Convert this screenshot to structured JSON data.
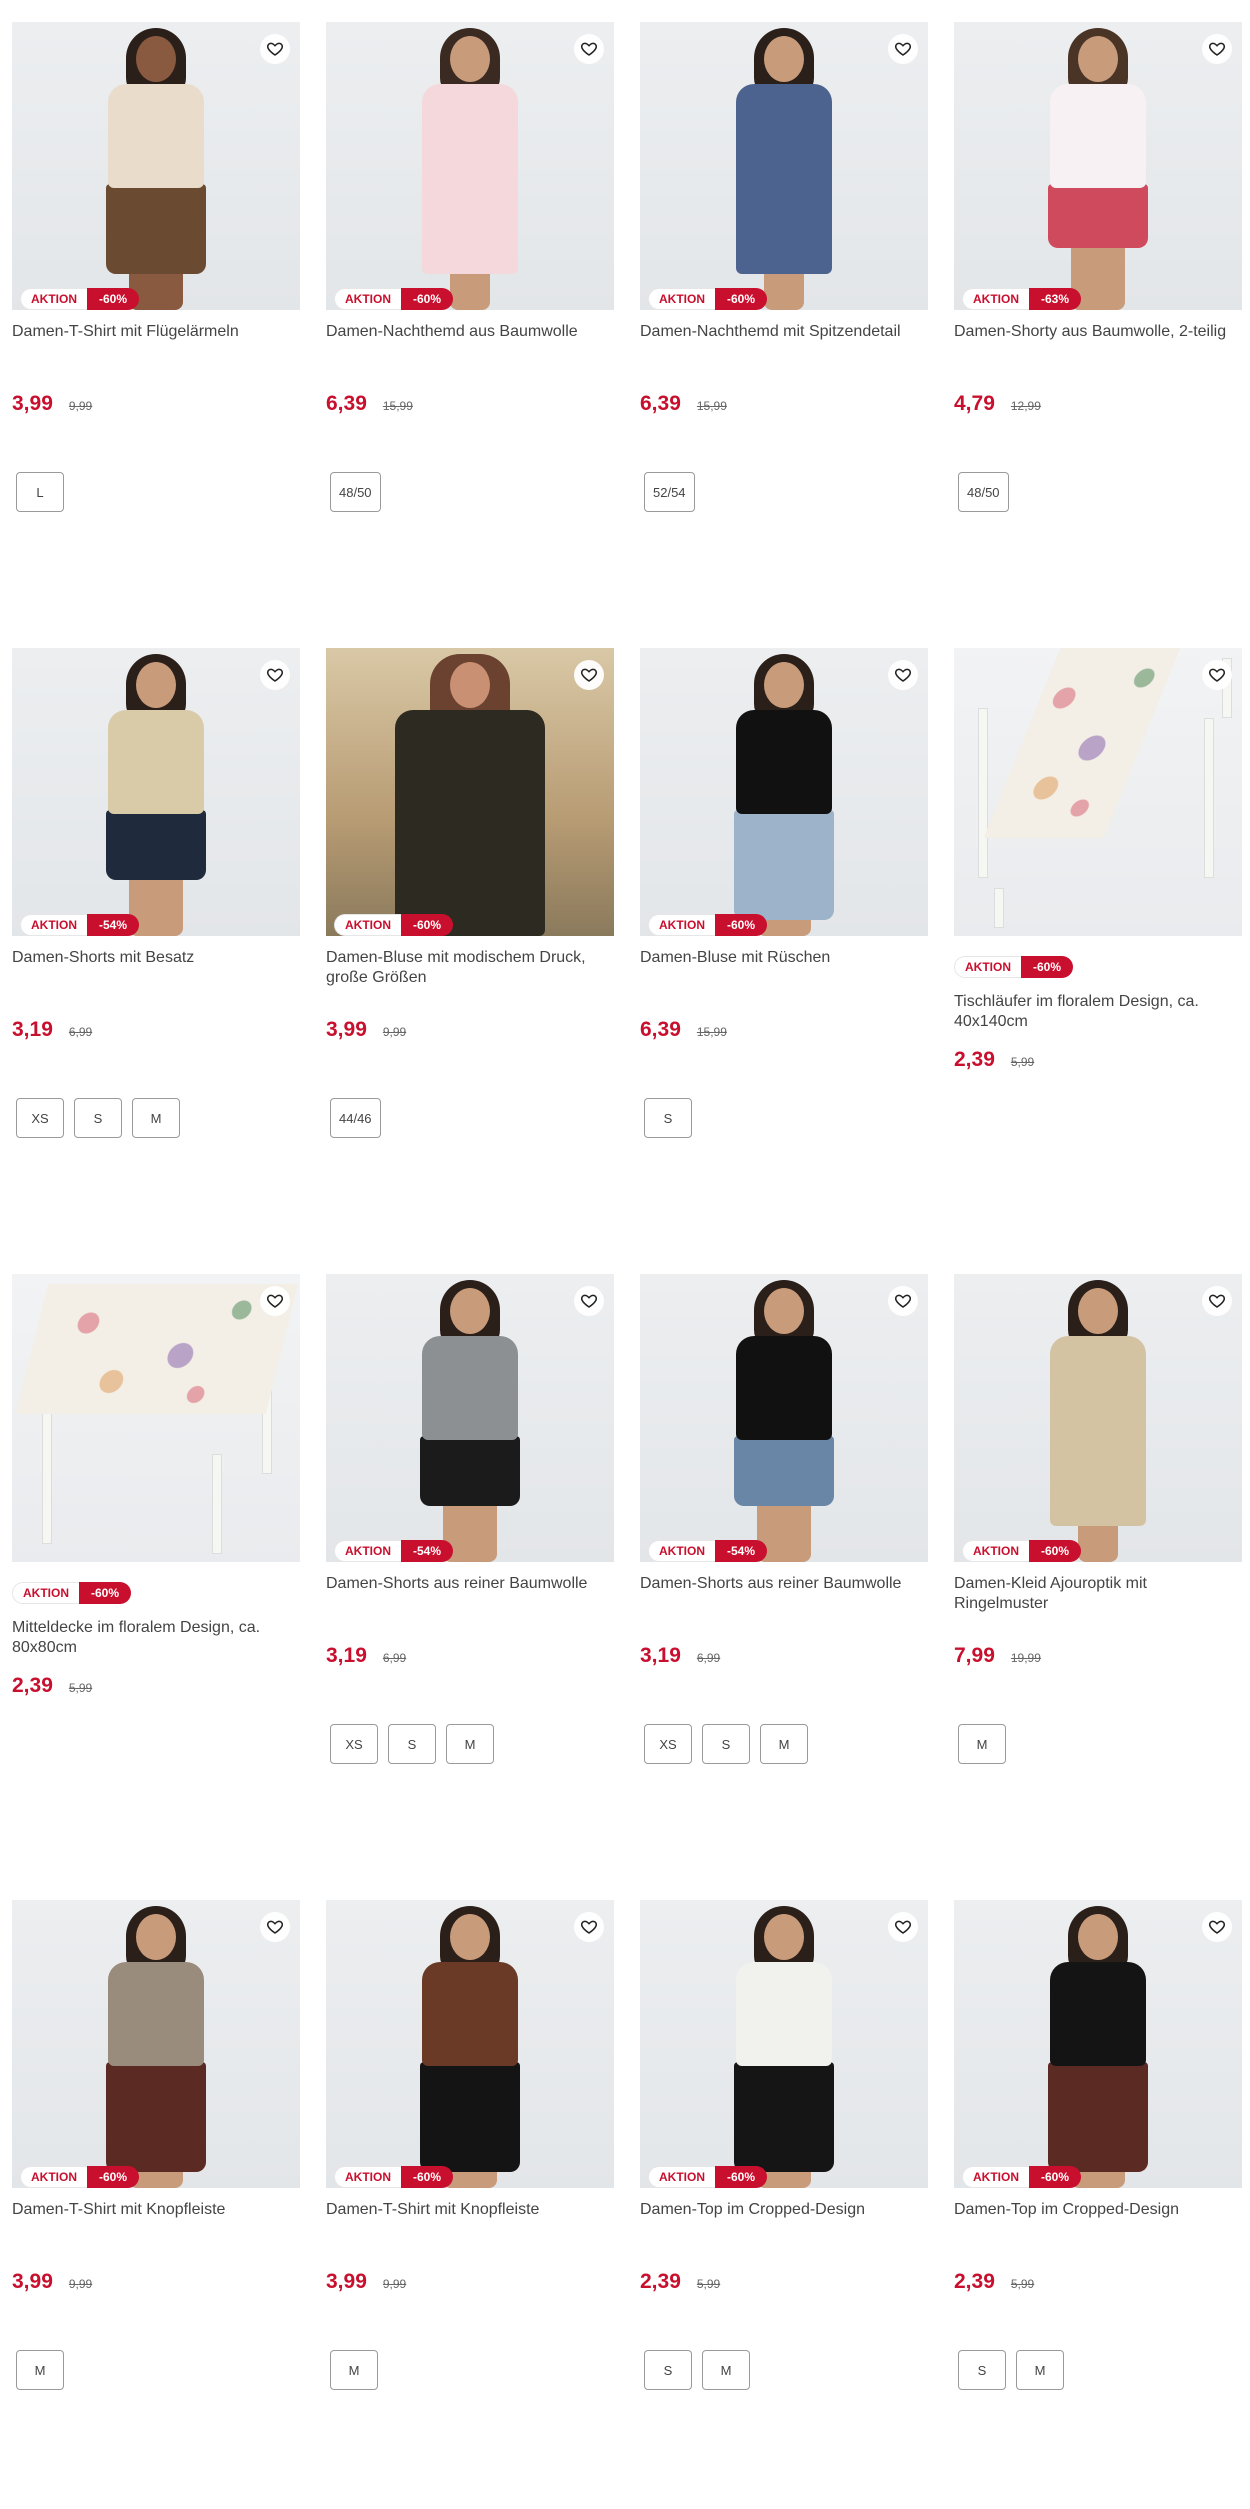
{
  "colors": {
    "accent": "#c8102e",
    "text": "#444444",
    "border": "#9a9a9a"
  },
  "icons": {
    "wishlist": "heart-outline-icon"
  },
  "products": [
    {
      "title": "Damen-T-Shirt mit Flügelärmeln",
      "badge": "AKTION",
      "discount": "-60%",
      "price": "3,99",
      "old_price": "9,99",
      "sizes": [
        "L"
      ],
      "image": "model-beige-top-leopard-skirt"
    },
    {
      "title": "Damen-Nachthemd aus Baumwolle",
      "badge": "AKTION",
      "discount": "-60%",
      "price": "6,39",
      "old_price": "15,99",
      "sizes": [
        "48/50"
      ],
      "image": "model-floral-nightgown"
    },
    {
      "title": "Damen-Nachthemd mit Spitzendetail",
      "badge": "AKTION",
      "discount": "-60%",
      "price": "6,39",
      "old_price": "15,99",
      "sizes": [
        "52/54"
      ],
      "image": "model-blue-nightgown"
    },
    {
      "title": "Damen-Shorty aus Baumwolle, 2-teilig",
      "badge": "AKTION",
      "discount": "-63%",
      "price": "4,79",
      "old_price": "12,99",
      "sizes": [
        "48/50"
      ],
      "image": "model-white-top-red-shorts"
    },
    {
      "title": "Damen-Shorts mit Besatz",
      "badge": "AKTION",
      "discount": "-54%",
      "price": "3,19",
      "old_price": "6,99",
      "sizes": [
        "XS",
        "S",
        "M"
      ],
      "image": "model-striped-top-navy-shorts"
    },
    {
      "title": "Damen-Bluse mit modischem Druck, große Größen",
      "badge": "AKTION",
      "discount": "-60%",
      "price": "3,99",
      "old_price": "9,99",
      "sizes": [
        "44/46"
      ],
      "image": "model-paisley-blouse"
    },
    {
      "title": "Damen-Bluse mit Rüschen",
      "badge": "AKTION",
      "discount": "-60%",
      "price": "6,39",
      "old_price": "15,99",
      "sizes": [
        "S"
      ],
      "image": "model-black-ruffle-blouse"
    },
    {
      "title": "Tischläufer im floralem Design, ca. 40x140cm",
      "badge": "AKTION",
      "discount": "-60%",
      "price": "2,39",
      "old_price": "5,99",
      "sizes": [],
      "image": "floral-table-runner"
    },
    {
      "title": "Mitteldecke im floralem Design, ca. 80x80cm",
      "badge": "AKTION",
      "discount": "-60%",
      "price": "2,39",
      "old_price": "5,99",
      "sizes": [],
      "image": "floral-tablecloth"
    },
    {
      "title": "Damen-Shorts aus reiner Baumwolle",
      "badge": "AKTION",
      "discount": "-54%",
      "price": "3,19",
      "old_price": "6,99",
      "sizes": [
        "XS",
        "S",
        "M"
      ],
      "image": "model-black-shorts"
    },
    {
      "title": "Damen-Shorts aus reiner Baumwolle",
      "badge": "AKTION",
      "discount": "-54%",
      "price": "3,19",
      "old_price": "6,99",
      "sizes": [
        "XS",
        "S",
        "M"
      ],
      "image": "model-denim-shorts"
    },
    {
      "title": "Damen-Kleid Ajouroptik mit Ringelmuster",
      "badge": "AKTION",
      "discount": "-60%",
      "price": "7,99",
      "old_price": "19,99",
      "sizes": [
        "M"
      ],
      "image": "model-striped-dress"
    },
    {
      "title": "Damen-T-Shirt mit Knopfleiste",
      "badge": "AKTION",
      "discount": "-60%",
      "price": "3,99",
      "old_price": "9,99",
      "sizes": [
        "M"
      ],
      "image": "model-taupe-shirt"
    },
    {
      "title": "Damen-T-Shirt mit Knopfleiste",
      "badge": "AKTION",
      "discount": "-60%",
      "price": "3,99",
      "old_price": "9,99",
      "sizes": [
        "M"
      ],
      "image": "model-brown-shirt"
    },
    {
      "title": "Damen-Top im Cropped-Design",
      "badge": "AKTION",
      "discount": "-60%",
      "price": "2,39",
      "old_price": "5,99",
      "sizes": [
        "S",
        "M"
      ],
      "image": "model-white-crop-top"
    },
    {
      "title": "Damen-Top im Cropped-Design",
      "badge": "AKTION",
      "discount": "-60%",
      "price": "2,39",
      "old_price": "5,99",
      "sizes": [
        "S",
        "M"
      ],
      "image": "model-black-crop-top"
    }
  ]
}
